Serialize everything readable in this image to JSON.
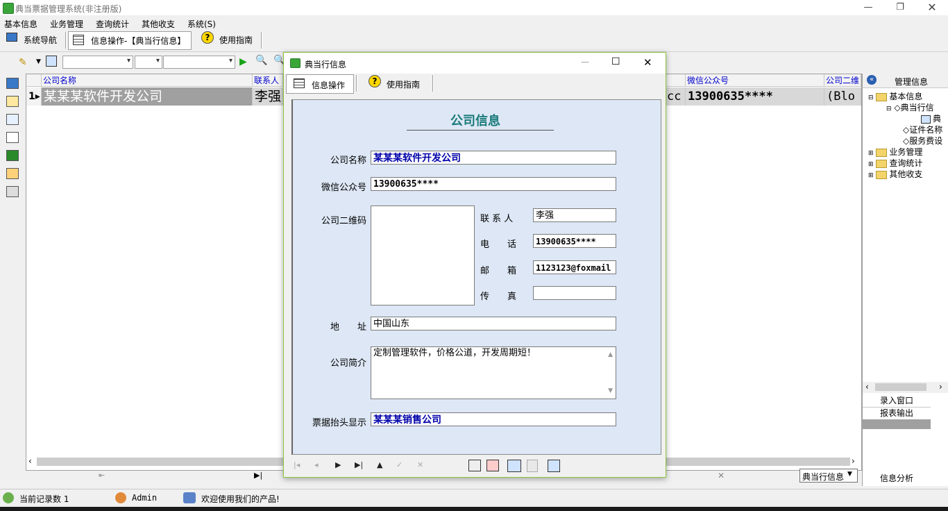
{
  "window": {
    "title": "典当票据管理系统(非注册版)"
  },
  "menu": [
    "基本信息",
    "业务管理",
    "查询统计",
    "其他收支",
    "系统(S)"
  ],
  "toolbar1": {
    "nav_label": "系统导航",
    "info_tab_label": "信息操作-【典当行信息】",
    "guide_label": "使用指南"
  },
  "grid": {
    "columns": [
      "公司名称",
      "联系人",
      "微信公众号",
      "公司二维"
    ],
    "row_indicator": "1▸",
    "row": {
      "name": "某某某软件开发公司",
      "contact": "李强",
      "cc": "cc",
      "wechat": "13900635****",
      "qr": "(Blo"
    }
  },
  "grid_bottom": {
    "combo_value": "典当行信息"
  },
  "right_panel": {
    "title": "管理信息",
    "tree": [
      {
        "label": "基本信息",
        "level": 0
      },
      {
        "label": "典当行信",
        "level": 1
      },
      {
        "label": "典",
        "level": 2
      },
      {
        "label": "证件名称",
        "level": 1
      },
      {
        "label": "服务费设",
        "level": 1
      },
      {
        "label": "业务管理",
        "level": 0
      },
      {
        "label": "查询统计",
        "level": 0
      },
      {
        "label": "其他收支",
        "level": 0
      }
    ],
    "buttons": [
      "录入窗口",
      "报表输出"
    ],
    "footer": "信息分析"
  },
  "status": {
    "record_count": "当前记录数 1",
    "user": "Admin",
    "welcome": "欢迎使用我们的产品!"
  },
  "dialog": {
    "title": "典当行信息",
    "tab_info": "信息操作",
    "tab_guide": "使用指南",
    "form_title": "公司信息",
    "labels": {
      "company_name": "公司名称",
      "wechat": "微信公众号",
      "qr": "公司二维码",
      "contact": "联 系 人",
      "phone": "电　　话",
      "email": "邮　　箱",
      "fax": "传　　真",
      "address": "地　　址",
      "intro": "公司简介",
      "receipt_header": "票据抬头显示"
    },
    "values": {
      "company_name": "某某某软件开发公司",
      "wechat": "13900635****",
      "contact": "李强",
      "phone": "13900635****",
      "email": "1123123@foxmail",
      "fax": "",
      "address": "中国山东",
      "intro": "定制管理软件，价格公道，开发周期短！",
      "receipt_header": "某某某销售公司"
    }
  }
}
